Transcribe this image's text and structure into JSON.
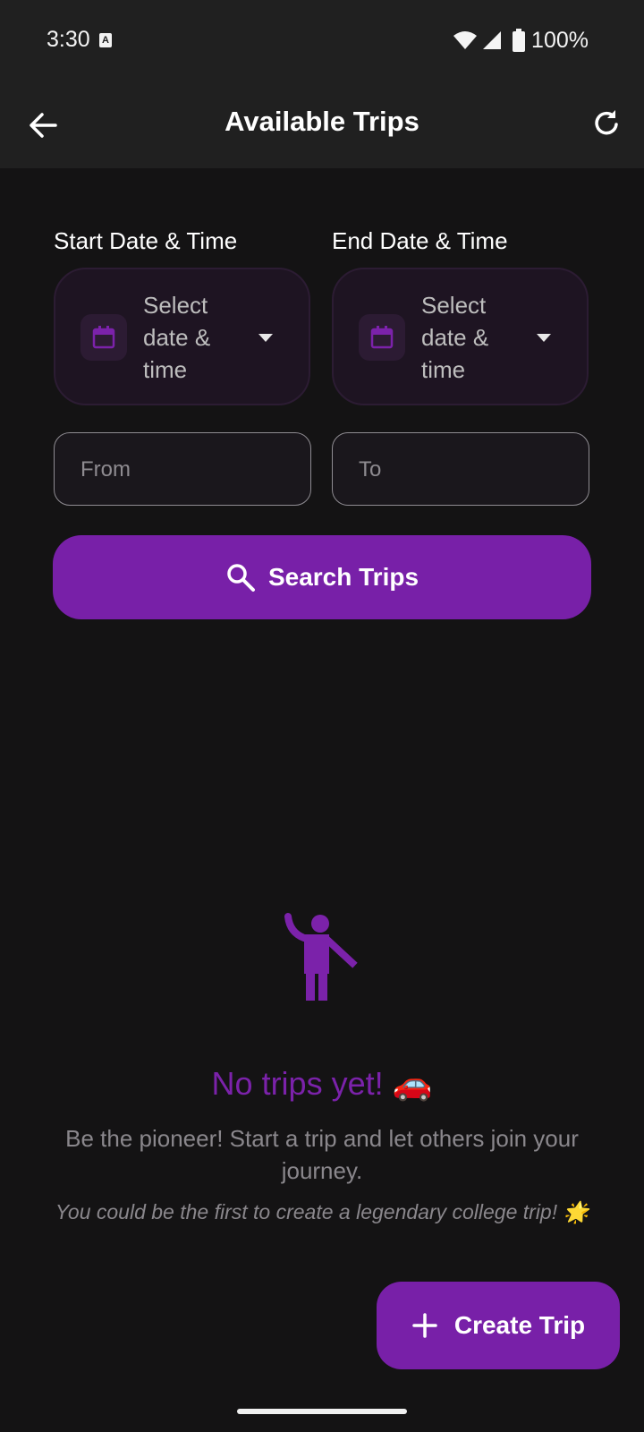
{
  "status_bar": {
    "time": "3:30",
    "notification_badge": "A",
    "battery": "100%"
  },
  "app_bar": {
    "title": "Available Trips"
  },
  "filters": {
    "start_label": "Start Date & Time",
    "end_label": "End Date & Time",
    "start_placeholder": "Select date & time",
    "end_placeholder": "Select date & time",
    "from_placeholder": "From",
    "to_placeholder": "To"
  },
  "search_button": {
    "label": "Search Trips"
  },
  "empty_state": {
    "title": "No trips yet! 🚗",
    "subtitle": "Be the pioneer! Start a trip and let others join your journey.",
    "hint": "You could be the first to create a legendary college trip! 🌟"
  },
  "fab": {
    "label": "Create Trip"
  },
  "colors": {
    "accent": "#7820a8",
    "background": "#141314",
    "app_bar": "#202020"
  },
  "icons": [
    "back-arrow-icon",
    "refresh-icon",
    "calendar-icon",
    "dropdown-caret-icon",
    "search-icon",
    "waving-person-icon",
    "plus-icon",
    "wifi-icon",
    "signal-icon",
    "battery-icon"
  ]
}
